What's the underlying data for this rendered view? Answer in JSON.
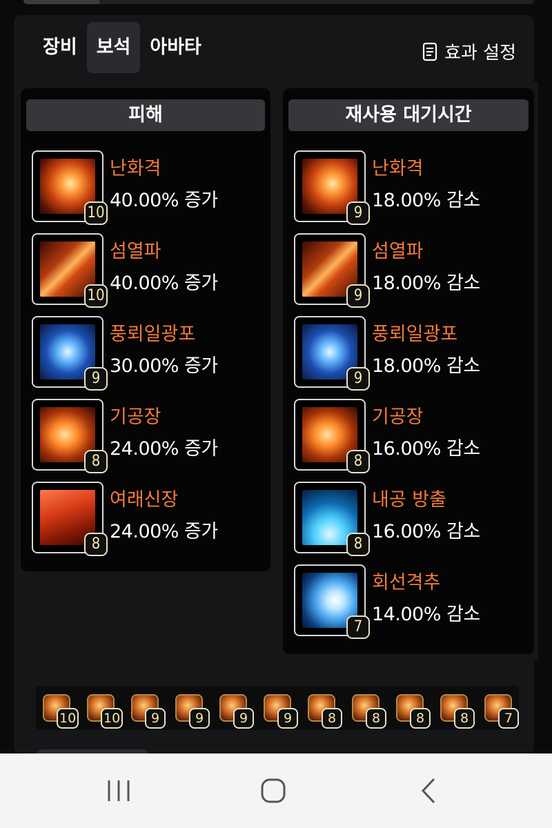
{
  "tabs": [
    {
      "label": "장비",
      "active": false
    },
    {
      "label": "보석",
      "active": true
    },
    {
      "label": "아바타",
      "active": false
    }
  ],
  "effect_settings_label": "효과 설정",
  "damage": {
    "header": "피해",
    "gems": [
      {
        "name": "난화격",
        "value": "40.00% 증가",
        "level": "10",
        "icon": "fire-palm-icon"
      },
      {
        "name": "섬열파",
        "value": "40.00% 증가",
        "level": "10",
        "icon": "fire-slash-icon"
      },
      {
        "name": "풍뢰일광포",
        "value": "30.00% 증가",
        "level": "9",
        "icon": "blue-swirl-icon"
      },
      {
        "name": "기공장",
        "value": "24.00% 증가",
        "level": "8",
        "icon": "fire-shield-icon"
      },
      {
        "name": "여래신장",
        "value": "24.00% 증가",
        "level": "8",
        "icon": "red-palm-icon"
      }
    ]
  },
  "cooldown": {
    "header": "재사용 대기시간",
    "gems": [
      {
        "name": "난화격",
        "value": "18.00% 감소",
        "level": "9",
        "icon": "fire-palm-icon"
      },
      {
        "name": "섬열파",
        "value": "18.00% 감소",
        "level": "9",
        "icon": "fire-slash-icon"
      },
      {
        "name": "풍뢰일광포",
        "value": "18.00% 감소",
        "level": "9",
        "icon": "blue-swirl-icon"
      },
      {
        "name": "기공장",
        "value": "16.00% 감소",
        "level": "8",
        "icon": "fire-shield-icon"
      },
      {
        "name": "내공 방출",
        "value": "16.00% 감소",
        "level": "8",
        "icon": "blue-leg-icon"
      },
      {
        "name": "회선격추",
        "value": "14.00% 감소",
        "level": "7",
        "icon": "blue-burst-icon"
      }
    ]
  },
  "gem_strip": [
    "10",
    "10",
    "9",
    "9",
    "9",
    "9",
    "8",
    "8",
    "8",
    "8",
    "7"
  ],
  "colors": {
    "skill_name": "#f07a3c",
    "level_text": "#f6e7a6",
    "panel_bg": "#151618",
    "card_bg": "#050505",
    "header_bg": "#35373a"
  }
}
